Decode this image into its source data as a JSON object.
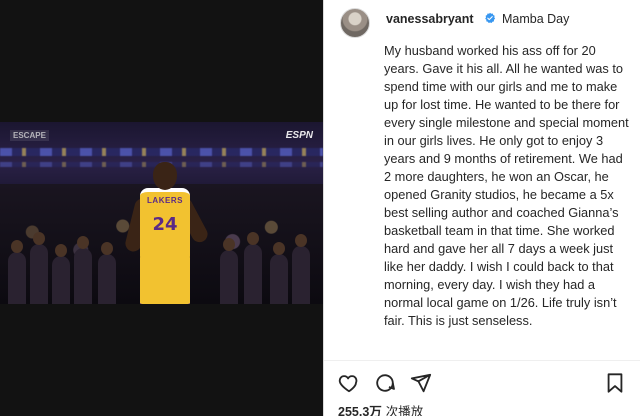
{
  "media": {
    "overlay_left": "ESCAPE",
    "overlay_right": "ESPN",
    "jersey_team": "LAKERS",
    "jersey_number": "24"
  },
  "post": {
    "username": "vanessabryant",
    "header_caption": "Mamba Day",
    "caption": "My husband worked his ass off for 20 years. Gave it his all. All he wanted was to spend time with our girls and me to make up for lost time. He wanted to be there for every single milestone and special moment in our girls lives. He only got to enjoy 3 years and 9 months of retirement. We had 2 more daughters, he won an Oscar, he opened Granity studios, he became a 5x best selling author and coached Gianna’s basketball team in that time. She worked hard and gave her all 7 days a week just like her daddy. I wish I could back to that morning, every day. I wish they had a normal local game on 1/26. Life truly isn’t fair. This is just senseless.",
    "views_count": "255.3万",
    "views_label": "次播放"
  },
  "icons": {
    "verified": "verified-badge-icon",
    "like": "heart-icon",
    "comment": "comment-icon",
    "share": "paper-plane-icon",
    "save": "bookmark-icon"
  },
  "colors": {
    "verified_blue": "#3897f0",
    "text": "#262626",
    "border": "#dbdbdb",
    "jersey_gold": "#f2c230",
    "jersey_purple": "#5b2a86"
  }
}
